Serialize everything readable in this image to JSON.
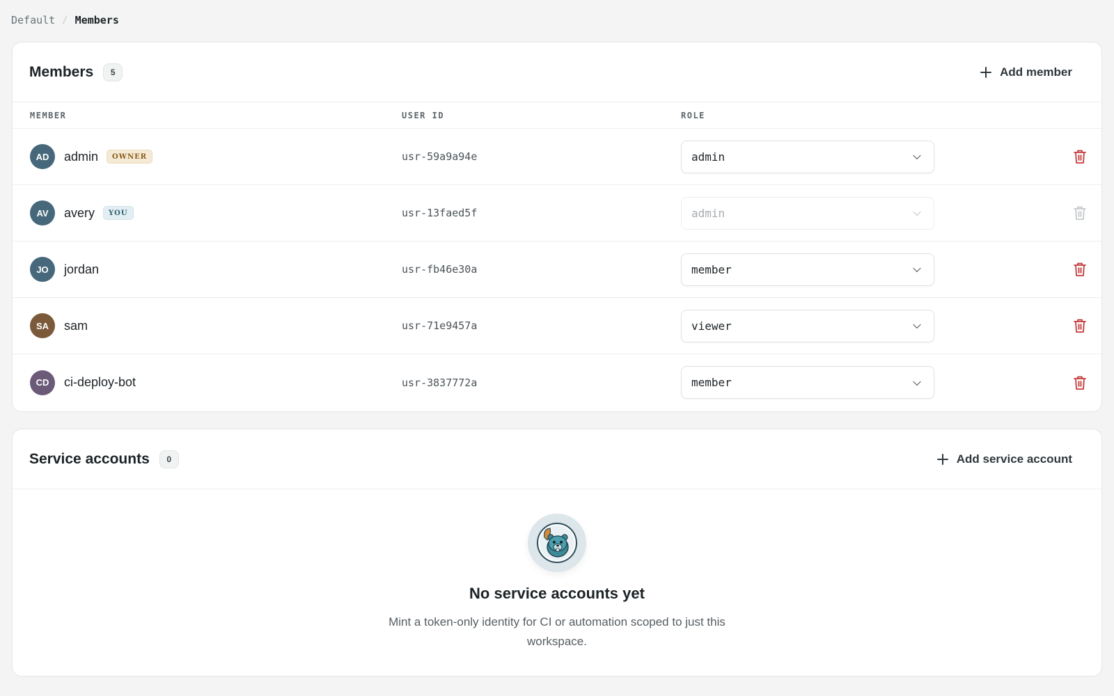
{
  "breadcrumb": {
    "parent": "Default",
    "separator": "/",
    "current": "Members"
  },
  "members": {
    "title": "Members",
    "count": "5",
    "add_label": "Add member",
    "columns": {
      "member": "MEMBER",
      "user_id": "USER ID",
      "role": "ROLE"
    },
    "rows": [
      {
        "initials": "AD",
        "name": "admin",
        "tag": "OWNER",
        "user_id": "usr-59a9a94e",
        "role": "admin",
        "avatar_color": "#46687a",
        "disabled": false
      },
      {
        "initials": "AV",
        "name": "avery",
        "tag": "YOU",
        "user_id": "usr-13faed5f",
        "role": "admin",
        "avatar_color": "#46687a",
        "disabled": true
      },
      {
        "initials": "JO",
        "name": "jordan",
        "tag": "",
        "user_id": "usr-fb46e30a",
        "role": "member",
        "avatar_color": "#46687a",
        "disabled": false
      },
      {
        "initials": "SA",
        "name": "sam",
        "tag": "",
        "user_id": "usr-71e9457a",
        "role": "viewer",
        "avatar_color": "#7a5a3a",
        "disabled": false
      },
      {
        "initials": "CD",
        "name": "ci-deploy-bot",
        "tag": "",
        "user_id": "usr-3837772a",
        "role": "member",
        "avatar_color": "#6b5a78",
        "disabled": false
      }
    ]
  },
  "service_accounts": {
    "title": "Service accounts",
    "count": "0",
    "add_label": "Add service account",
    "empty_title": "No service accounts yet",
    "empty_desc": "Mint a token-only identity for CI or automation scoped to just this workspace."
  },
  "colors": {
    "delete": "#c23a3a",
    "delete_disabled": "#c4c9cb",
    "tag_owner_bg": "#f5ead6",
    "tag_you_bg": "#e3eef2"
  },
  "icons": [
    "plus-icon",
    "chevron-down-icon",
    "trash-icon",
    "beaver-mascot-icon"
  ]
}
